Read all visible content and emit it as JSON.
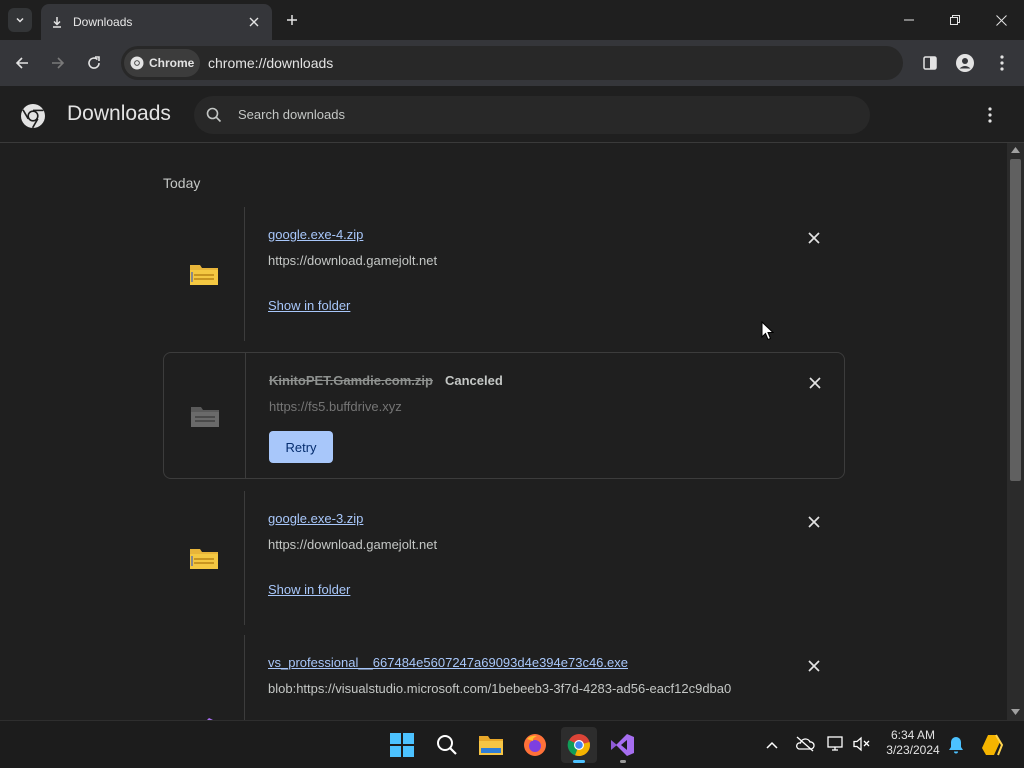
{
  "tab": {
    "title": "Downloads"
  },
  "toolbar": {
    "chip_label": "Chrome",
    "url": "chrome://downloads"
  },
  "page": {
    "title": "Downloads",
    "search_placeholder": "Search downloads"
  },
  "section": {
    "label": "Today"
  },
  "downloads": [
    {
      "filename": "google.exe-4.zip",
      "url": "https://download.gamejolt.net",
      "action": "Show in folder",
      "status": ""
    },
    {
      "filename": "KinitoPET.Gamdie.com.zip",
      "url": "https://fs5.buffdrive.xyz",
      "action": "Retry",
      "status": "Canceled"
    },
    {
      "filename": "google.exe-3.zip",
      "url": "https://download.gamejolt.net",
      "action": "Show in folder",
      "status": ""
    },
    {
      "filename": "vs_professional__667484e5607247a69093d4e394e73c46.exe",
      "url": "blob:https://visualstudio.microsoft.com/1bebeeb3-3f7d-4283-ad56-eacf12c9dba0",
      "action": "",
      "status": ""
    }
  ],
  "clock": {
    "time": "6:34 AM",
    "date": "3/23/2024"
  },
  "colors": {
    "accent": "#a8c7fa",
    "background": "#1f1f1f",
    "toolbar": "#35363a"
  }
}
